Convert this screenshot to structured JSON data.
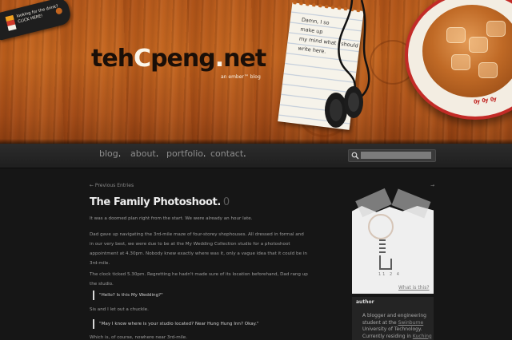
{
  "header": {
    "tag_line1": "looking for the drink?",
    "tag_line2": "CLICK HERE!",
    "logo_part1": "teh",
    "logo_part2": "C",
    "logo_part3": "peng",
    "logo_part4": ".",
    "logo_part5": "net",
    "tagline": "an ember™ blog",
    "note_lines": [
      "Damn, I so",
      "make up",
      "my mind what I should",
      "write here."
    ],
    "mug_text": "Ѹ Ѹ Ѹ"
  },
  "nav": {
    "items": [
      {
        "label": "blog",
        "dot": "."
      },
      {
        "label": "about",
        "dot": "."
      },
      {
        "label": "portfolio",
        "dot": "."
      },
      {
        "label": "contact",
        "dot": "."
      }
    ],
    "search_placeholder": ""
  },
  "post": {
    "prev_link": "← Previous Entries",
    "next_link": "→",
    "title": "The Family Photoshoot.",
    "comment_count": "0",
    "paragraphs": [
      [
        "It was a doomed plan right from the start. We were already an hour late."
      ],
      [
        "Dad gave up navigating the 3rd-mile maze of four-storey shophouses. All dressed in formal and",
        "in our very best, we were due to be at the My Wedding Collection studio for a photoshoot",
        "appointment at 4.30pm. Nobody knew exactly where was it, only a vague idea that it could be in",
        "3rd-mile."
      ],
      [
        "The clock ticked 5.30pm. Regretting he hadn't made sure of its location beforehand, Dad rang up",
        "the studio."
      ]
    ],
    "quote1": "\"Hello? Is this My Wedding?\"",
    "after_quote1": "Sis and I let out a chuckle.",
    "quote2": "\"May I know where is your studio located? Near Hung Hung Inn? Okay.\"",
    "last_line": "Which is, of course, nowhere near 3rd-mile."
  },
  "sidebar": {
    "mini_dates": "11 2 4",
    "what_link": "What is this?",
    "author_heading": "author",
    "author_lines": [
      "A blogger and engineering",
      "student at the",
      "University of Technology.",
      "Currently residing in"
    ],
    "author_link1": "Swinburne",
    "author_link2": "Kuching",
    "colors": {
      "accent": "#c2641f",
      "mug_red": "#c32b27",
      "bg": "#161616"
    }
  }
}
